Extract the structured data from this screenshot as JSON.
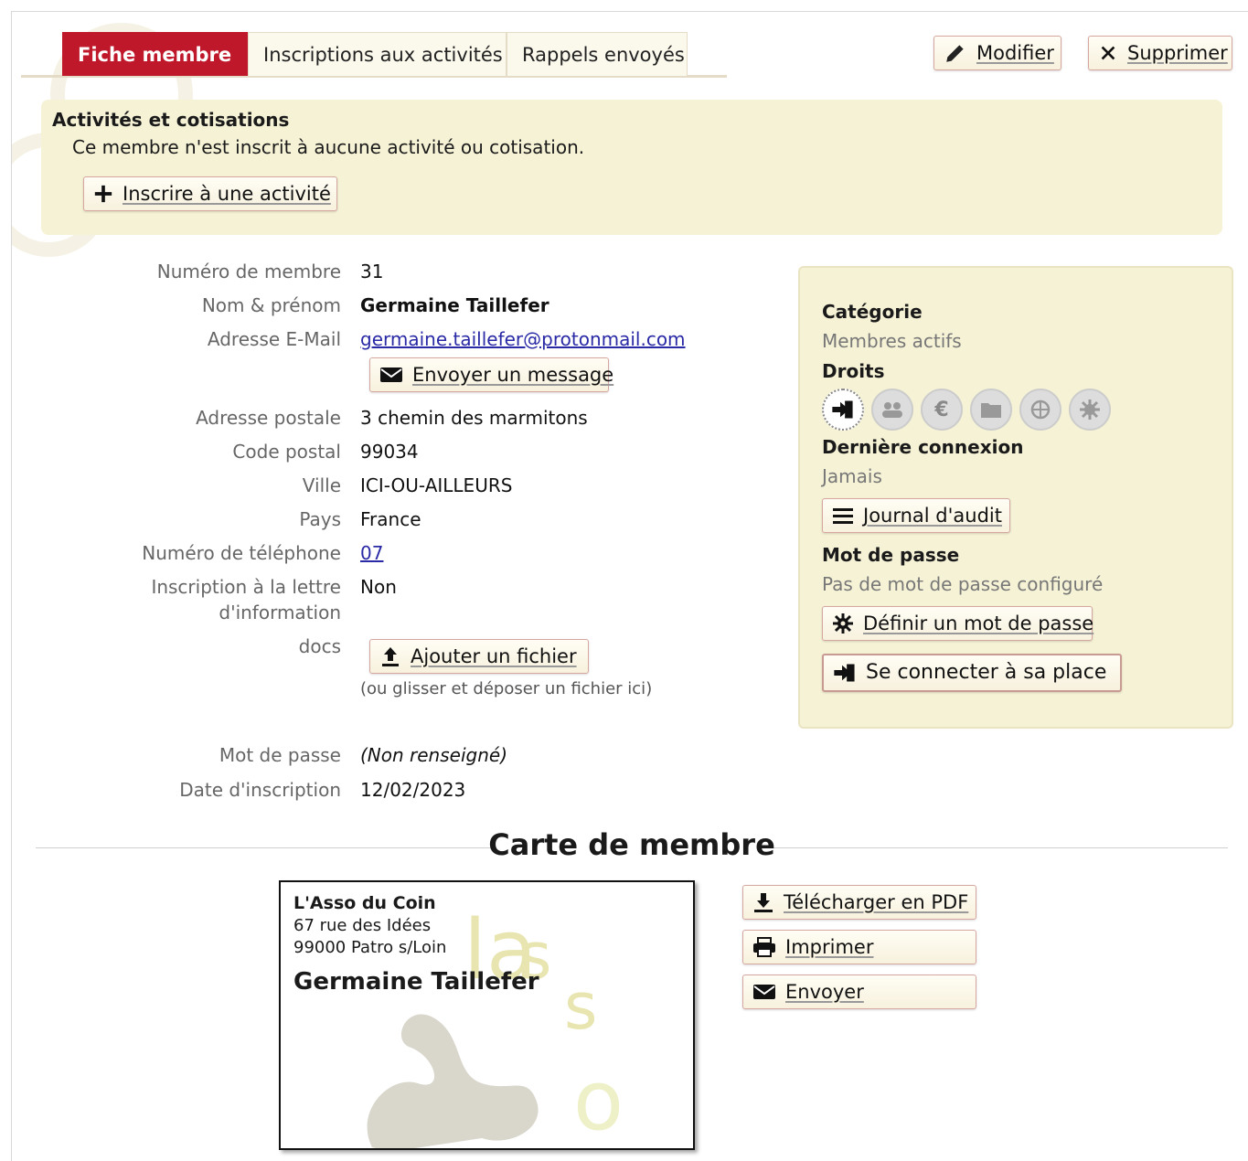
{
  "tabs": [
    {
      "label": "Fiche membre",
      "active": true
    },
    {
      "label": "Inscriptions aux activités",
      "active": false
    },
    {
      "label": "Rappels envoyés",
      "active": false
    }
  ],
  "actions": {
    "edit": "Modifier",
    "delete": "Supprimer"
  },
  "activities": {
    "title": "Activités et cotisations",
    "empty": "Ce membre n'est inscrit à aucune activité ou cotisation.",
    "subscribe": "Inscrire à une activité"
  },
  "fields": {
    "number": {
      "label": "Numéro de membre",
      "value": "31"
    },
    "name": {
      "label": "Nom & prénom",
      "value": "Germaine Taillefer"
    },
    "email": {
      "label": "Adresse E-Mail",
      "value": "germaine.taillefer@protonmail.com",
      "send": "Envoyer un message"
    },
    "address": {
      "label": "Adresse postale",
      "value": "3 chemin des marmitons"
    },
    "zip": {
      "label": "Code postal",
      "value": "99034"
    },
    "city": {
      "label": "Ville",
      "value": "ICI-OU-AILLEURS"
    },
    "country": {
      "label": "Pays",
      "value": "France"
    },
    "phone": {
      "label": "Numéro de téléphone",
      "value": "07"
    },
    "newsletter": {
      "label_line1": "Inscription à la lettre",
      "label_line2": "d'information",
      "value": "Non"
    },
    "docs": {
      "label": "docs",
      "button": "Ajouter un fichier",
      "hint": "(ou glisser et déposer un fichier ici)"
    },
    "password": {
      "label": "Mot de passe",
      "value": "(Non renseigné)"
    },
    "date": {
      "label": "Date d'inscription",
      "value": "12/02/2023"
    }
  },
  "side": {
    "category_label": "Catégorie",
    "category_value": "Membres actifs",
    "rights_label": "Droits",
    "rights_icons": [
      "login-icon",
      "users-icon",
      "euro-icon",
      "folder-icon",
      "web-icon",
      "config-icon"
    ],
    "last_login_label": "Dernière connexion",
    "last_login_value": "Jamais",
    "audit": "Journal d'audit",
    "password_label": "Mot de passe",
    "password_value": "Pas de mot de passe configuré",
    "set_password": "Définir un mot de passe",
    "login_as": "Se connecter à sa place"
  },
  "card": {
    "section_title": "Carte de membre",
    "org": "L'Asso du Coin",
    "addr1": "67 rue des Idées",
    "addr2": "99000 Patro s/Loin",
    "name": "Germaine Taillefer",
    "download": "Télécharger en PDF",
    "print": "Imprimer",
    "send": "Envoyer"
  },
  "colors": {
    "accent": "#c0182b",
    "panel": "#f6f2d6",
    "link": "#2a2aa6"
  }
}
